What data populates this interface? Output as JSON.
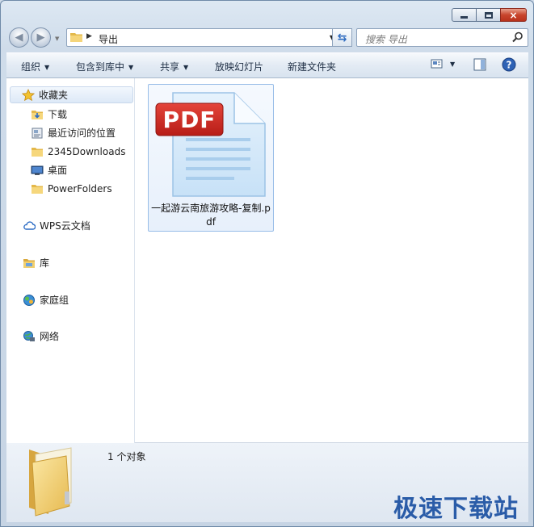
{
  "window": {
    "caption": {
      "minimize": "minimize",
      "maximize": "maximize",
      "close": "×"
    }
  },
  "address": {
    "path": "导出"
  },
  "search": {
    "placeholder": "搜索 导出"
  },
  "toolbar": {
    "organize": "组织",
    "include_in_library": "包含到库中",
    "share": "共享",
    "slideshow": "放映幻灯片",
    "new_folder": "新建文件夹"
  },
  "nav": {
    "favorites": "收藏夹",
    "favorites_items": [
      {
        "label": "下载",
        "icon": "download-folder-icon"
      },
      {
        "label": "最近访问的位置",
        "icon": "recent-places-icon"
      },
      {
        "label": "2345Downloads",
        "icon": "folder-icon"
      },
      {
        "label": "桌面",
        "icon": "desktop-icon"
      },
      {
        "label": "PowerFolders",
        "icon": "folder-icon"
      }
    ],
    "wps_cloud": "WPS云文档",
    "libraries": "库",
    "homegroup": "家庭组",
    "network": "网络"
  },
  "file": {
    "badge": "PDF",
    "name": "一起游云南旅游攻略-复制.pdf"
  },
  "details": {
    "count": "1 个对象"
  },
  "watermark": "极速下载站",
  "colors": {
    "pdf_red": "#d42a23",
    "accent": "#2a5ca8"
  }
}
